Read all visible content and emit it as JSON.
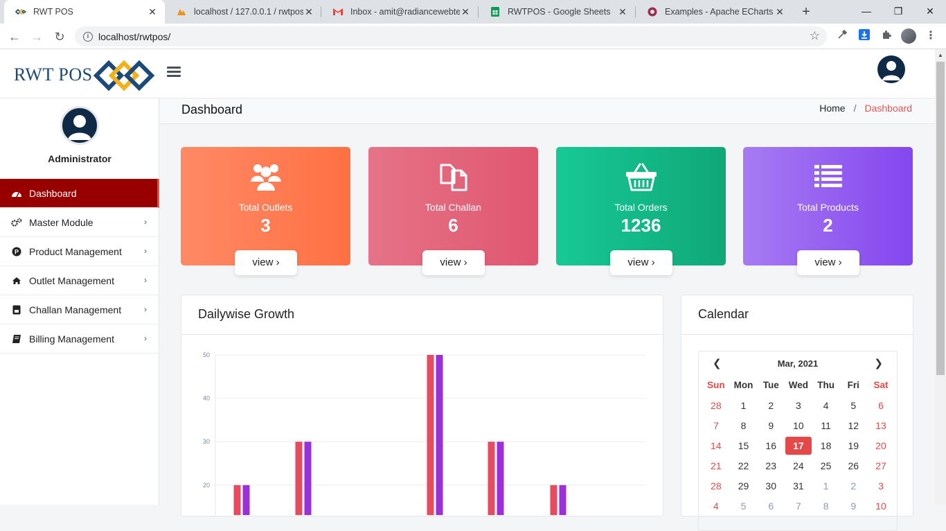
{
  "browser": {
    "tabs": [
      {
        "title": "RWT POS",
        "active": true
      },
      {
        "title": "localhost / 127.0.0.1 / rwtpos /",
        "active": false
      },
      {
        "title": "Inbox - amit@radiancewebtec",
        "active": false
      },
      {
        "title": "RWTPOS - Google Sheets",
        "active": false
      },
      {
        "title": "Examples - Apache ECharts",
        "active": false
      }
    ],
    "url": "localhost/rwtpos/"
  },
  "header": {
    "logo_text": "RWT POS"
  },
  "sidebar": {
    "user_name": "Administrator",
    "items": [
      {
        "label": "Dashboard"
      },
      {
        "label": "Master Module"
      },
      {
        "label": "Product Management"
      },
      {
        "label": "Outlet Management"
      },
      {
        "label": "Challan Management"
      },
      {
        "label": "Billing Management"
      }
    ]
  },
  "page": {
    "title": "Dashboard",
    "breadcrumb": {
      "home": "Home",
      "separator": "/",
      "current": "Dashboard"
    }
  },
  "stats": [
    {
      "label": "Total Outlets",
      "value": "3",
      "button": "view ›",
      "icon": "users-icon"
    },
    {
      "label": "Total Challan",
      "value": "6",
      "button": "view ›",
      "icon": "copy-icon"
    },
    {
      "label": "Total Orders",
      "value": "1236",
      "button": "view ›",
      "icon": "basket-icon"
    },
    {
      "label": "Total Products",
      "value": "2",
      "button": "view ›",
      "icon": "list-icon"
    }
  ],
  "growth_card": {
    "title": "Dailywise Growth"
  },
  "chart_data": {
    "type": "bar",
    "ylim": [
      0,
      50
    ],
    "y_ticks": [
      "20",
      "30",
      "40",
      "50"
    ],
    "grid": true,
    "series": [
      {
        "values": [
          20,
          30,
          50,
          30,
          20
        ],
        "color": "#e84a5f"
      },
      {
        "values": [
          20,
          30,
          50,
          30,
          20
        ],
        "color": "#9b30d9"
      }
    ]
  },
  "calendar": {
    "title": "Calendar",
    "month_label": "Mar, 2021",
    "weekdays": [
      "Sun",
      "Mon",
      "Tue",
      "Wed",
      "Thu",
      "Fri",
      "Sat"
    ],
    "weeks": [
      [
        "28",
        "1",
        "2",
        "3",
        "4",
        "5",
        "6"
      ],
      [
        "7",
        "8",
        "9",
        "10",
        "11",
        "12",
        "13"
      ],
      [
        "14",
        "15",
        "16",
        "17",
        "18",
        "19",
        "20"
      ],
      [
        "21",
        "22",
        "23",
        "24",
        "25",
        "26",
        "27"
      ],
      [
        "28",
        "29",
        "30",
        "31",
        "1",
        "2",
        "3"
      ],
      [
        "4",
        "5",
        "6",
        "7",
        "8",
        "9",
        "10"
      ]
    ],
    "today": "17"
  },
  "colors": {
    "active_menu": "#980000",
    "accent_red": "#e54848",
    "card_outlets": [
      "#ff8a65",
      "#ff7043"
    ],
    "card_challan": [
      "#e57388",
      "#e0566f"
    ],
    "card_orders": [
      "#16c995",
      "#0fa877"
    ],
    "card_products": [
      "#a77bf3",
      "#8446ef"
    ]
  }
}
